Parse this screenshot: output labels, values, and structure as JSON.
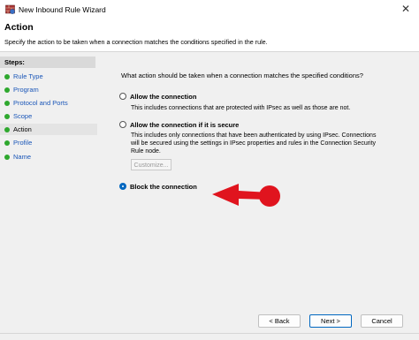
{
  "window": {
    "title": "New Inbound Rule Wizard"
  },
  "header": {
    "title": "Action",
    "description": "Specify the action to be taken when a connection matches the conditions specified in the rule."
  },
  "steps": {
    "heading": "Steps:",
    "items": [
      {
        "label": "Rule Type"
      },
      {
        "label": "Program"
      },
      {
        "label": "Protocol and Ports"
      },
      {
        "label": "Scope"
      },
      {
        "label": "Action"
      },
      {
        "label": "Profile"
      },
      {
        "label": "Name"
      }
    ],
    "current": "Action"
  },
  "main": {
    "question": "What action should be taken when a connection matches the specified conditions?",
    "options": [
      {
        "label": "Allow the connection",
        "description": "This includes connections that are protected with IPsec as well as those are not.",
        "selected": false
      },
      {
        "label": "Allow the connection if it is secure",
        "description_lines": [
          "This includes only connections that have been authenticated by using IPsec.  Connections",
          "will be secured using the settings in IPsec properties and rules in the Connection Security",
          "Rule node."
        ],
        "selected": false
      },
      {
        "label": "Block the connection",
        "selected": true
      }
    ],
    "customize_label": "Customize..."
  },
  "footer": {
    "back_label": "< Back",
    "next_label": "Next >",
    "cancel_label": "Cancel"
  },
  "colors": {
    "accent": "#0067c0",
    "annotation_arrow": "#e0141e",
    "step_dot": "#2ea82e",
    "step_link": "#1a56b8"
  },
  "icons": [
    "firewall-app-icon",
    "close-icon",
    "step-dot-icon",
    "red-arrow-annotation"
  ]
}
